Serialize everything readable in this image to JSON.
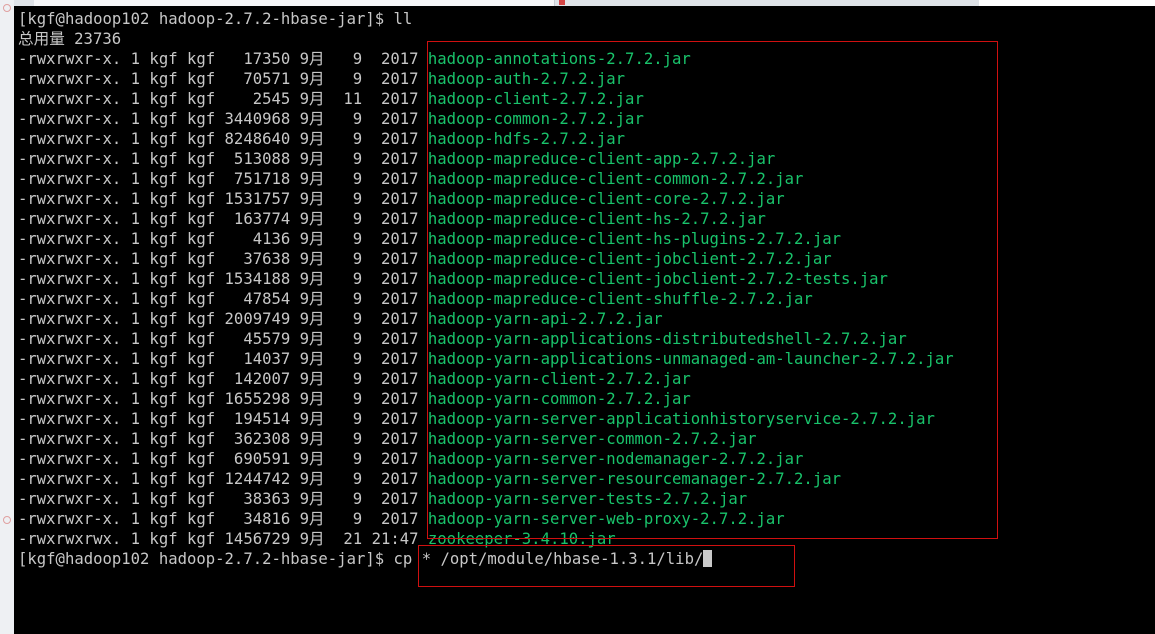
{
  "terminal": {
    "prompt": "[kgf@hadoop102 hadoop-2.7.2-hbase-jar]$ ",
    "first_command": "ll",
    "total_line": "总用量 23736",
    "rows": [
      {
        "perms": "-rwxrwxr-x.",
        "links": "1",
        "owner": "kgf",
        "group": "kgf",
        "size": "17350",
        "month": "9月",
        "day": "9",
        "time": "2017",
        "name": "hadoop-annotations-2.7.2.jar"
      },
      {
        "perms": "-rwxrwxr-x.",
        "links": "1",
        "owner": "kgf",
        "group": "kgf",
        "size": "70571",
        "month": "9月",
        "day": "9",
        "time": "2017",
        "name": "hadoop-auth-2.7.2.jar"
      },
      {
        "perms": "-rwxrwxr-x.",
        "links": "1",
        "owner": "kgf",
        "group": "kgf",
        "size": "2545",
        "month": "9月",
        "day": "11",
        "time": "2017",
        "name": "hadoop-client-2.7.2.jar"
      },
      {
        "perms": "-rwxrwxr-x.",
        "links": "1",
        "owner": "kgf",
        "group": "kgf",
        "size": "3440968",
        "month": "9月",
        "day": "9",
        "time": "2017",
        "name": "hadoop-common-2.7.2.jar"
      },
      {
        "perms": "-rwxrwxr-x.",
        "links": "1",
        "owner": "kgf",
        "group": "kgf",
        "size": "8248640",
        "month": "9月",
        "day": "9",
        "time": "2017",
        "name": "hadoop-hdfs-2.7.2.jar"
      },
      {
        "perms": "-rwxrwxr-x.",
        "links": "1",
        "owner": "kgf",
        "group": "kgf",
        "size": "513088",
        "month": "9月",
        "day": "9",
        "time": "2017",
        "name": "hadoop-mapreduce-client-app-2.7.2.jar"
      },
      {
        "perms": "-rwxrwxr-x.",
        "links": "1",
        "owner": "kgf",
        "group": "kgf",
        "size": "751718",
        "month": "9月",
        "day": "9",
        "time": "2017",
        "name": "hadoop-mapreduce-client-common-2.7.2.jar"
      },
      {
        "perms": "-rwxrwxr-x.",
        "links": "1",
        "owner": "kgf",
        "group": "kgf",
        "size": "1531757",
        "month": "9月",
        "day": "9",
        "time": "2017",
        "name": "hadoop-mapreduce-client-core-2.7.2.jar"
      },
      {
        "perms": "-rwxrwxr-x.",
        "links": "1",
        "owner": "kgf",
        "group": "kgf",
        "size": "163774",
        "month": "9月",
        "day": "9",
        "time": "2017",
        "name": "hadoop-mapreduce-client-hs-2.7.2.jar"
      },
      {
        "perms": "-rwxrwxr-x.",
        "links": "1",
        "owner": "kgf",
        "group": "kgf",
        "size": "4136",
        "month": "9月",
        "day": "9",
        "time": "2017",
        "name": "hadoop-mapreduce-client-hs-plugins-2.7.2.jar"
      },
      {
        "perms": "-rwxrwxr-x.",
        "links": "1",
        "owner": "kgf",
        "group": "kgf",
        "size": "37638",
        "month": "9月",
        "day": "9",
        "time": "2017",
        "name": "hadoop-mapreduce-client-jobclient-2.7.2.jar"
      },
      {
        "perms": "-rwxrwxr-x.",
        "links": "1",
        "owner": "kgf",
        "group": "kgf",
        "size": "1534188",
        "month": "9月",
        "day": "9",
        "time": "2017",
        "name": "hadoop-mapreduce-client-jobclient-2.7.2-tests.jar"
      },
      {
        "perms": "-rwxrwxr-x.",
        "links": "1",
        "owner": "kgf",
        "group": "kgf",
        "size": "47854",
        "month": "9月",
        "day": "9",
        "time": "2017",
        "name": "hadoop-mapreduce-client-shuffle-2.7.2.jar"
      },
      {
        "perms": "-rwxrwxr-x.",
        "links": "1",
        "owner": "kgf",
        "group": "kgf",
        "size": "2009749",
        "month": "9月",
        "day": "9",
        "time": "2017",
        "name": "hadoop-yarn-api-2.7.2.jar"
      },
      {
        "perms": "-rwxrwxr-x.",
        "links": "1",
        "owner": "kgf",
        "group": "kgf",
        "size": "45579",
        "month": "9月",
        "day": "9",
        "time": "2017",
        "name": "hadoop-yarn-applications-distributedshell-2.7.2.jar"
      },
      {
        "perms": "-rwxrwxr-x.",
        "links": "1",
        "owner": "kgf",
        "group": "kgf",
        "size": "14037",
        "month": "9月",
        "day": "9",
        "time": "2017",
        "name": "hadoop-yarn-applications-unmanaged-am-launcher-2.7.2.jar"
      },
      {
        "perms": "-rwxrwxr-x.",
        "links": "1",
        "owner": "kgf",
        "group": "kgf",
        "size": "142007",
        "month": "9月",
        "day": "9",
        "time": "2017",
        "name": "hadoop-yarn-client-2.7.2.jar"
      },
      {
        "perms": "-rwxrwxr-x.",
        "links": "1",
        "owner": "kgf",
        "group": "kgf",
        "size": "1655298",
        "month": "9月",
        "day": "9",
        "time": "2017",
        "name": "hadoop-yarn-common-2.7.2.jar"
      },
      {
        "perms": "-rwxrwxr-x.",
        "links": "1",
        "owner": "kgf",
        "group": "kgf",
        "size": "194514",
        "month": "9月",
        "day": "9",
        "time": "2017",
        "name": "hadoop-yarn-server-applicationhistoryservice-2.7.2.jar"
      },
      {
        "perms": "-rwxrwxr-x.",
        "links": "1",
        "owner": "kgf",
        "group": "kgf",
        "size": "362308",
        "month": "9月",
        "day": "9",
        "time": "2017",
        "name": "hadoop-yarn-server-common-2.7.2.jar"
      },
      {
        "perms": "-rwxrwxr-x.",
        "links": "1",
        "owner": "kgf",
        "group": "kgf",
        "size": "690591",
        "month": "9月",
        "day": "9",
        "time": "2017",
        "name": "hadoop-yarn-server-nodemanager-2.7.2.jar"
      },
      {
        "perms": "-rwxrwxr-x.",
        "links": "1",
        "owner": "kgf",
        "group": "kgf",
        "size": "1244742",
        "month": "9月",
        "day": "9",
        "time": "2017",
        "name": "hadoop-yarn-server-resourcemanager-2.7.2.jar"
      },
      {
        "perms": "-rwxrwxr-x.",
        "links": "1",
        "owner": "kgf",
        "group": "kgf",
        "size": "38363",
        "month": "9月",
        "day": "9",
        "time": "2017",
        "name": "hadoop-yarn-server-tests-2.7.2.jar"
      },
      {
        "perms": "-rwxrwxr-x.",
        "links": "1",
        "owner": "kgf",
        "group": "kgf",
        "size": "34816",
        "month": "9月",
        "day": "9",
        "time": "2017",
        "name": "hadoop-yarn-server-web-proxy-2.7.2.jar"
      },
      {
        "perms": "-rwxrwxrwx.",
        "links": "1",
        "owner": "kgf",
        "group": "kgf",
        "size": "1456729",
        "month": "9月",
        "day": "21",
        "time": "21:47",
        "name": "zookeeper-3.4.10.jar"
      }
    ],
    "last_command": "cp * /opt/module/hbase-1.3.1/lib/"
  },
  "colors": {
    "background": "#000000",
    "text": "#c7c7c7",
    "file_name": "#19c36b",
    "highlight_box": "#d01010"
  }
}
